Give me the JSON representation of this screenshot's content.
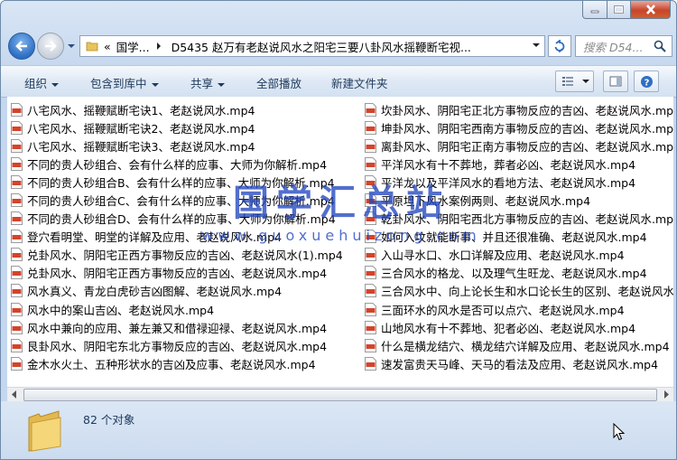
{
  "address": {
    "crumbs": [
      "«",
      "国学...",
      "D5435 赵万有老赵说风水之阳宅三要八卦风水摇鞭断宅视..."
    ]
  },
  "search": {
    "placeholder": "搜索 D54..."
  },
  "toolbar": {
    "organize": "组织",
    "include_in_library": "包含到库中",
    "share": "共享",
    "play_all": "全部播放",
    "new_folder": "新建文件夹"
  },
  "files_left": [
    "八宅风水、摇鞭赋断宅诀1、老赵说风水.mp4",
    "八宅风水、摇鞭赋断宅诀2、老赵说风水.mp4",
    "八宅风水、摇鞭赋断宅诀3、老赵说风水.mp4",
    "不同的贵人砂组合、会有什么样的应事、大师为你解析.mp4",
    "不同的贵人砂组合B、会有什么样的应事、大师为你解析.mp4",
    "不同的贵人砂组合C、会有什么样的应事、大师为你解析.mp4",
    "不同的贵人砂组合D、会有什么样的应事、大师为你解析.mp4",
    "登穴看明堂、明堂的详解及应用、老赵说风水.mp4",
    "兑卦风水、阴阳宅正西方事物反应的吉凶、老赵说风水(1).mp4",
    "兑卦风水、阴阳宅正西方事物反应的吉凶、老赵说风水.mp4",
    "风水真义、青龙白虎砂吉凶图解、老赵说风水.mp4",
    "风水中的案山吉凶、老赵说风水.mp4",
    "风水中兼向的应用、兼左兼又和借禄迎禄、老赵说风水.mp4",
    "艮卦风水、阴阳宅东北方事物反应的吉凶、老赵说风水.mp4",
    "金木水火土、五种形状水的吉凶及应事、老赵说风水.mp4"
  ],
  "files_right": [
    "坎卦风水、阴阳宅正北方事物反应的吉凶、老赵说风水.mp4",
    "坤卦风水、阴阳宅西南方事物反应的吉凶、老赵说风水.mp4",
    "离卦风水、阴阳宅正南方事物反应的吉凶、老赵说风水.mp4",
    "平洋风水有十不葬地，葬者必凶、老赵说风水.mp4",
    "平洋龙以及平洋风水的看地方法、老赵说风水.mp4",
    "平原坦下风水案例两则、老赵说风水.mp4",
    "乾卦风水、阴阳宅西北方事物反应的吉凶、老赵说风水.mp4",
    "如何入坟就能断事、并且还很准确、老赵说风水.mp4",
    "入山寻水口、水口详解及应用、老赵说风水.mp4",
    "三合风水的格龙、以及理气生旺龙、老赵说风水.mp4",
    "三合风水中、向上论长生和水口论长生的区别、老赵说风水.mp4",
    "三面环水的风水是否可以点穴、老赵说风水.mp4",
    "山地风水有十不葬地、犯者必凶、老赵说风水.mp4",
    "什么是横龙结穴、横龙结穴详解及应用、老赵说风水.mp4",
    "速发富贵天马峰、天马的看法及应用、老赵说风水.mp4"
  ],
  "status": {
    "item_count": "82 个对象"
  },
  "watermark": {
    "cn": "国学汇总站",
    "en": "www.guoxuehuizong.com"
  },
  "colors": {
    "accent": "#2d6fc3",
    "file_icon_red": "#d2442c",
    "watermark": "#2346be"
  }
}
